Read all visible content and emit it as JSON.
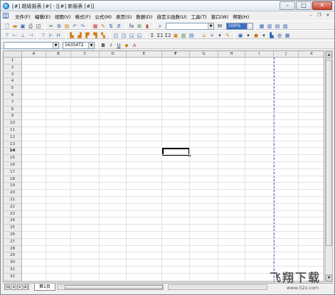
{
  "window": {
    "title": "[#] 超级报表 [#] - [[#] 新报表 [#]]",
    "min_label": "–",
    "max_label": "□",
    "close_label": "✕"
  },
  "menubar": {
    "items": [
      "文件(F)",
      "编辑(E)",
      "视图(V)",
      "格式(F)",
      "公式(M)",
      "表页(S)",
      "数据(D)",
      "自定义函数(U)",
      "工具(T)",
      "窗口(W)",
      "帮助(H)"
    ],
    "mdi_min": "–",
    "mdi_restore": "❐",
    "mdi_close": "✕"
  },
  "toolbar": {
    "zoom_value": "100%",
    "font_name": "",
    "font_size": "",
    "search_value": "",
    "color_value": "16354T2",
    "bold": "B",
    "italic": "I",
    "underline": "U",
    "sum_label": "Σ",
    "sum_label2": "Σ1",
    "sum_label3": "Σ2",
    "fx_label": "fx",
    "find_label": "M",
    "text_color": "A",
    "icons": [
      "new-icon",
      "open-icon",
      "save-icon",
      "print-icon",
      "preview-icon",
      "cut-icon",
      "copy-icon",
      "paste-icon",
      "undo-icon",
      "redo-icon",
      "table-icon",
      "format-brush-icon",
      "sort-asc-icon",
      "sort-desc-icon",
      "function-icon",
      "binoculars-icon",
      "chart-icon"
    ]
  },
  "grid": {
    "columns": [
      "A",
      "B",
      "C",
      "D",
      "E",
      "F",
      "G",
      "H",
      "I",
      "J",
      "K"
    ],
    "rows": [
      "1",
      "2",
      "3",
      "4",
      "5",
      "6",
      "7",
      "8",
      "9",
      "10",
      "11",
      "12",
      "13",
      "14",
      "15",
      "16",
      "17",
      "18",
      "19",
      "20",
      "21",
      "22",
      "23",
      "24",
      "25",
      "26",
      "27",
      "28",
      "29",
      "30",
      "31",
      "32",
      "33"
    ],
    "active_row": "14",
    "active_col": "F"
  },
  "sheet_tabs": [
    "第1页"
  ],
  "watermark": {
    "text": "飞翔下载",
    "url": "www.52z.com"
  }
}
